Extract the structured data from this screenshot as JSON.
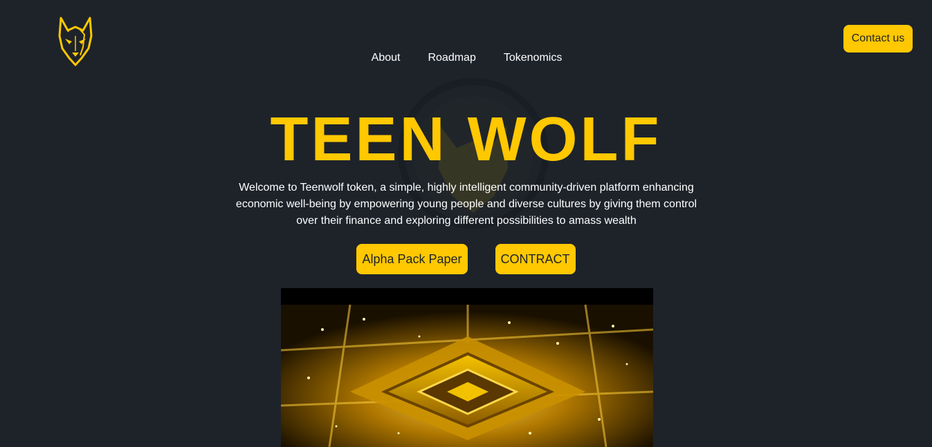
{
  "brand": {
    "logo_icon": "wolf-head-icon",
    "accent_color": "#ffc800",
    "background_color": "#1e232a"
  },
  "nav": {
    "items": [
      {
        "label": "About"
      },
      {
        "label": "Roadmap"
      },
      {
        "label": "Tokenomics"
      }
    ]
  },
  "header": {
    "contact_label": "Contact us"
  },
  "hero": {
    "title": "TEEN WOLF",
    "description": "Welcome to Teenwolf token, a simple, highly intelligent community-driven platform enhancing economic well-being by empowering young people and diverse cultures by giving them control over their finance and exploring different possibilities to amass wealth",
    "buttons": [
      {
        "label": "Alpha Pack Paper"
      },
      {
        "label": "CONTRACT"
      }
    ]
  },
  "media": {
    "icon": "golden-microchip-image"
  }
}
